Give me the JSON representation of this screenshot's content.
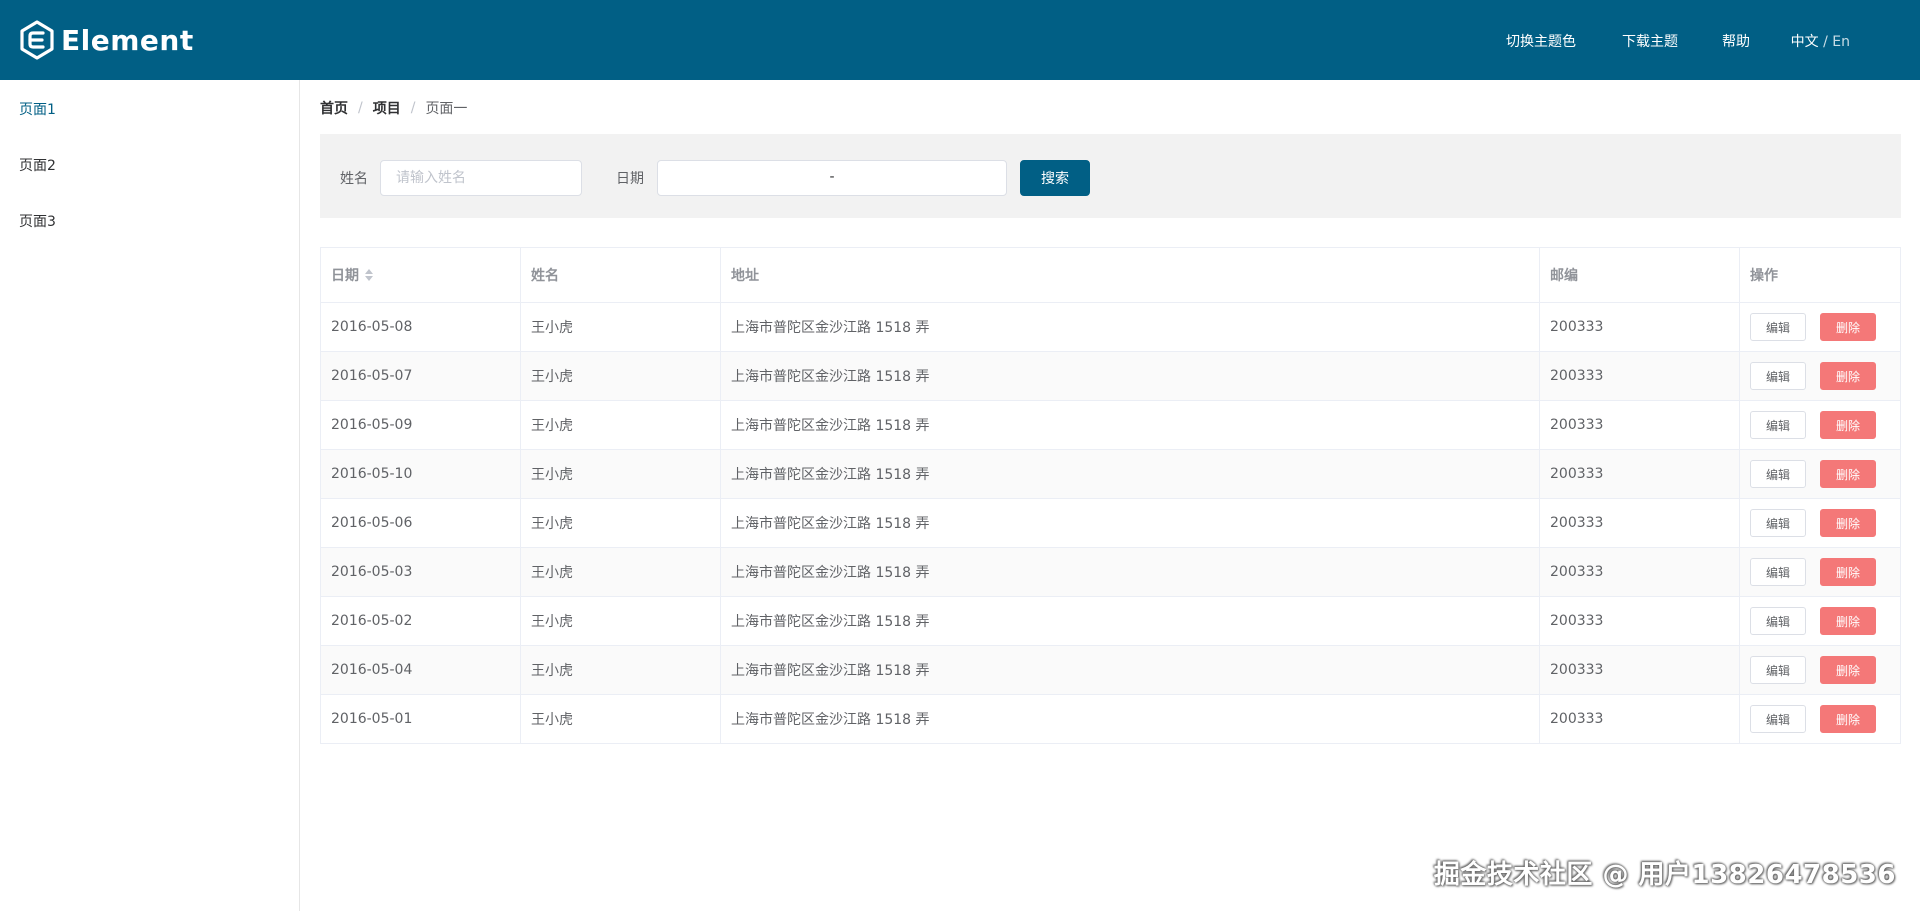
{
  "header": {
    "logo_text": "Element",
    "nav": {
      "switch_theme": "切换主题色",
      "download_theme": "下载主题",
      "help": "帮助",
      "lang_zh": "中文",
      "lang_sep": " / ",
      "lang_en": "En"
    },
    "bg_color": "#015f85"
  },
  "sidebar": {
    "items": [
      {
        "label": "页面1",
        "active": true
      },
      {
        "label": "页面2",
        "active": false
      },
      {
        "label": "页面3",
        "active": false
      }
    ]
  },
  "breadcrumb": {
    "items": [
      "首页",
      "项目",
      "页面一"
    ],
    "separator": "/"
  },
  "search": {
    "name_label": "姓名",
    "name_placeholder": "请输入姓名",
    "name_value": "",
    "date_label": "日期",
    "date_separator": "-",
    "search_button": "搜索"
  },
  "table": {
    "columns": [
      "日期",
      "姓名",
      "地址",
      "邮编",
      "操作"
    ],
    "edit_label": "编辑",
    "delete_label": "删除",
    "rows": [
      {
        "date": "2016-05-08",
        "name": "王小虎",
        "address": "上海市普陀区金沙江路 1518 弄",
        "zip": "200333"
      },
      {
        "date": "2016-05-07",
        "name": "王小虎",
        "address": "上海市普陀区金沙江路 1518 弄",
        "zip": "200333"
      },
      {
        "date": "2016-05-09",
        "name": "王小虎",
        "address": "上海市普陀区金沙江路 1518 弄",
        "zip": "200333"
      },
      {
        "date": "2016-05-10",
        "name": "王小虎",
        "address": "上海市普陀区金沙江路 1518 弄",
        "zip": "200333"
      },
      {
        "date": "2016-05-06",
        "name": "王小虎",
        "address": "上海市普陀区金沙江路 1518 弄",
        "zip": "200333"
      },
      {
        "date": "2016-05-03",
        "name": "王小虎",
        "address": "上海市普陀区金沙江路 1518 弄",
        "zip": "200333"
      },
      {
        "date": "2016-05-02",
        "name": "王小虎",
        "address": "上海市普陀区金沙江路 1518 弄",
        "zip": "200333"
      },
      {
        "date": "2016-05-04",
        "name": "王小虎",
        "address": "上海市普陀区金沙江路 1518 弄",
        "zip": "200333"
      },
      {
        "date": "2016-05-01",
        "name": "王小虎",
        "address": "上海市普陀区金沙江路 1518 弄",
        "zip": "200333"
      }
    ]
  },
  "watermark": "掘金技术社区 @ 用户13826478536"
}
